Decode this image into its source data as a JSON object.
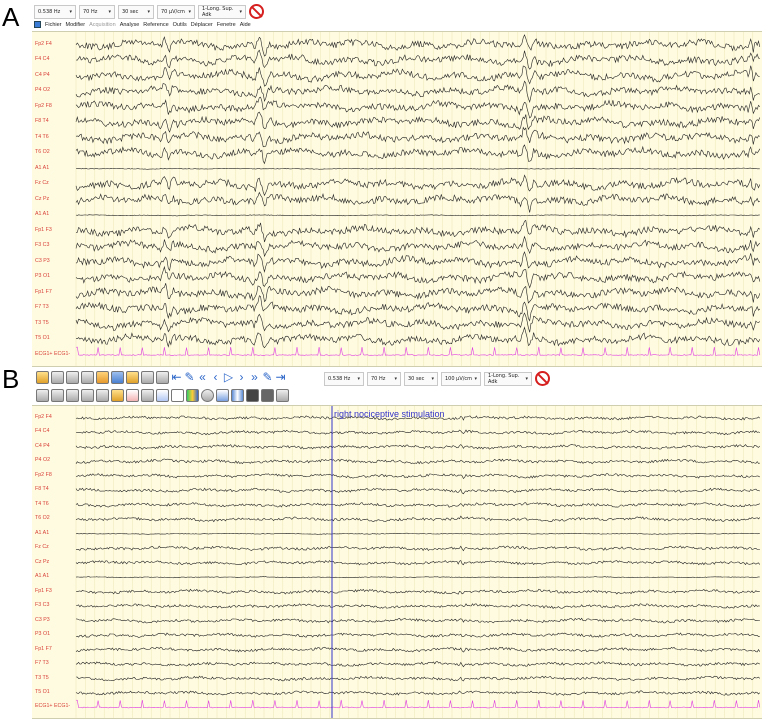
{
  "panel_a": {
    "letter": "A",
    "toolbar": {
      "highpass": "0.538 Hz",
      "lowpass": "70 Hz",
      "timebase": "30 sec",
      "gain": "70 µV/cm",
      "montage": "1-Long. Sup. Adk"
    },
    "menu": [
      "Fichier",
      "Modifier",
      "Acquisition",
      "Analyse",
      "Reference",
      "Outils",
      "Déplacer",
      "Fenetre",
      "Aide"
    ],
    "channels": [
      "Fp2 F4",
      "F4 C4",
      "C4 P4",
      "P4 O2",
      "Fp2 F8",
      "F8 T4",
      "T4 T6",
      "T6 O2",
      "A1 A1",
      "Fz Cz",
      "Cz Pz",
      "A1 A1",
      "Fp1 F3",
      "F3 C3",
      "C3 P3",
      "P3 O1",
      "Fp1 F7",
      "F7 T3",
      "T3 T5",
      "T5 O1",
      "ECG1+ ECG1-"
    ]
  },
  "panel_b": {
    "letter": "B",
    "toolbar": {
      "highpass": "0.538 Hz",
      "lowpass": "70 Hz",
      "timebase": "30 sec",
      "gain": "100 µV/cm",
      "montage": "1-Long. Sup. Adk"
    },
    "annotation": "right nociceptive stimulation",
    "channels": [
      "Fp2 F4",
      "F4 C4",
      "C4 P4",
      "P4 O2",
      "Fp2 F8",
      "F8 T4",
      "T4 T6",
      "T6 O2",
      "A1 A1",
      "Fz Cz",
      "Cz Pz",
      "A1 A1",
      "Fp1 F3",
      "F3 C3",
      "C3 P3",
      "P3 O1",
      "Fp1 F7",
      "F7 T3",
      "T3 T5",
      "T5 O1",
      "ECG1+ ECG1-"
    ]
  },
  "colors": {
    "chart_bg": "#fffbe0",
    "trace": "#222222",
    "ecg": "#e040e0",
    "label": "#d8413a",
    "marker": "#3434c8"
  }
}
